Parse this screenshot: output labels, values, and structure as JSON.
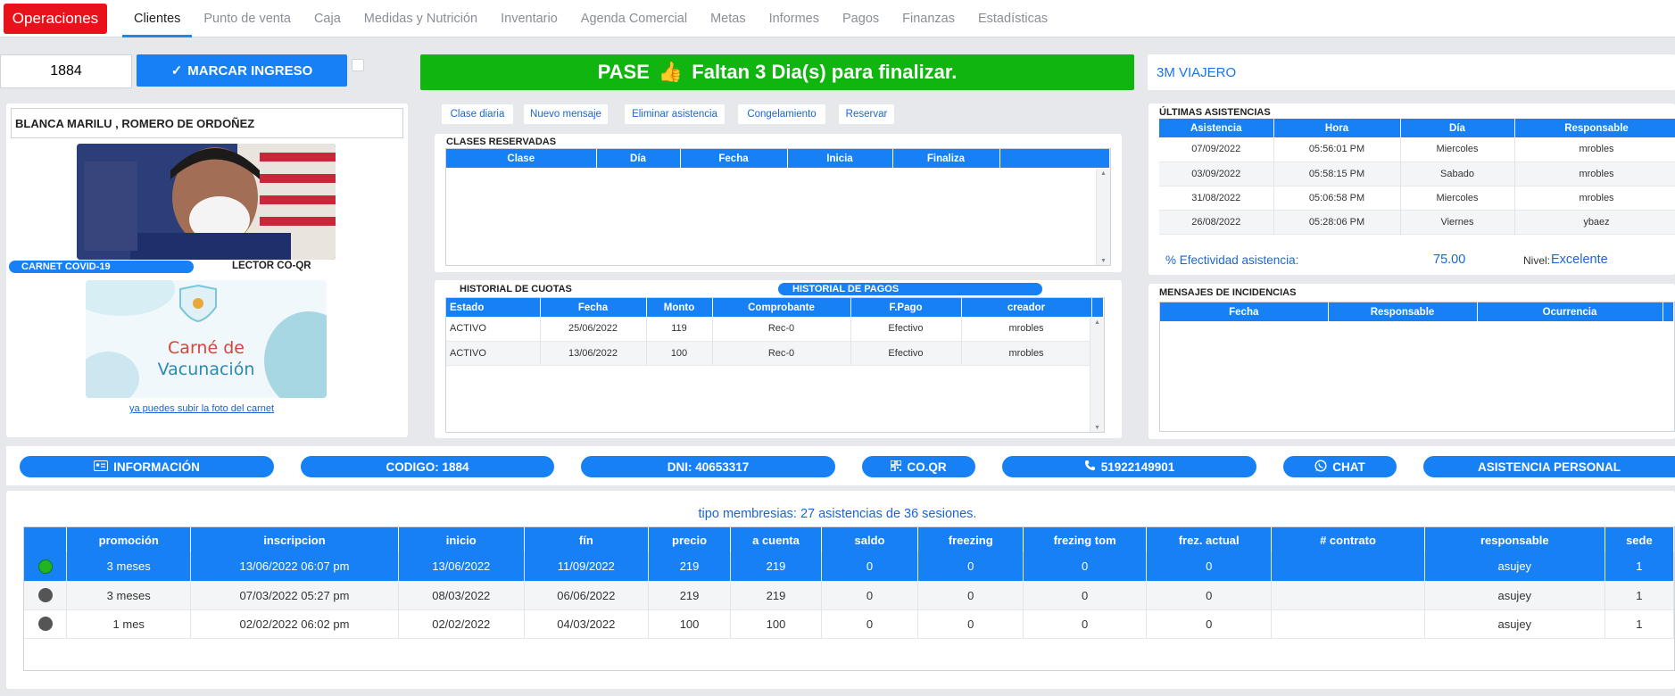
{
  "nav": {
    "brand": "Operaciones",
    "tabs": [
      "Clientes",
      "Punto de venta",
      "Caja",
      "Medidas y Nutrición",
      "Inventario",
      "Agenda Comercial",
      "Metas",
      "Informes",
      "Pagos",
      "Finanzas",
      "Estadísticas"
    ],
    "active_tab": "Clientes"
  },
  "checkin": {
    "code_value": "1884",
    "mark_button": "MARCAR INGRESO"
  },
  "pass": {
    "text_left": "PASE",
    "emoji": "👍",
    "text_right": "Faltan 3 Dia(s) para finalizar."
  },
  "plan_name": "3M VIAJERO",
  "client": {
    "name": "BLANCA MARILU , ROMERO DE ORDOÑEZ",
    "covid_label": "CARNET COVID-19",
    "qr_label": "LECTOR CO-QR",
    "vaccine_line1": "Carné de",
    "vaccine_line2": "Vacunación",
    "upload_link": "ya puedes subir la foto del carnet"
  },
  "actions": [
    "Clase diaria",
    "Nuevo mensaje",
    "Eliminar asistencia",
    "Congelamiento",
    "Reservar"
  ],
  "reserved": {
    "title": "CLASES RESERVADAS",
    "columns": [
      "Clase",
      "Día",
      "Fecha",
      "Inicia",
      "Finaliza",
      ""
    ]
  },
  "history": {
    "title_cuotas": "HISTORIAL DE CUOTAS",
    "title_pagos": "HISTORIAL DE PAGOS",
    "columns": [
      "Estado",
      "Fecha",
      "Monto",
      "Comprobante",
      "F.Pago",
      "creador"
    ],
    "rows": [
      [
        "ACTIVO",
        "25/06/2022",
        "119",
        "Rec-0",
        "Efectivo",
        "mrobles"
      ],
      [
        "ACTIVO",
        "13/06/2022",
        "100",
        "Rec-0",
        "Efectivo",
        "mrobles"
      ]
    ]
  },
  "attendance": {
    "title": "ÚLTIMAS ASISTENCIAS",
    "columns": [
      "Asistencia",
      "Hora",
      "Día",
      "Responsable"
    ],
    "rows": [
      [
        "07/09/2022",
        "05:56:01 PM",
        "Miercoles",
        "mrobles"
      ],
      [
        "03/09/2022",
        "05:58:15 PM",
        "Sabado",
        "mrobles"
      ],
      [
        "31/08/2022",
        "05:06:58 PM",
        "Miercoles",
        "mrobles"
      ],
      [
        "26/08/2022",
        "05:28:06 PM",
        "Viernes",
        "ybaez"
      ]
    ],
    "effectiveness_label": "% Efectividad asistencia:",
    "effectiveness_value": "75.00",
    "level_label": "Nivel:",
    "level_value": "Excelente"
  },
  "incidents": {
    "title": "MENSAJES DE INCIDENCIAS",
    "columns": [
      "Fecha",
      "Responsable",
      "Ocurrencia"
    ]
  },
  "info_bar": {
    "info": "INFORMACIÓN",
    "code": "CODIGO: 1884",
    "dni": "DNI: 40653317",
    "qr": "CO.QR",
    "phone": "51922149901",
    "chat": "CHAT",
    "personal": "ASISTENCIA PERSONAL"
  },
  "memberships": {
    "title": "tipo membresias: 27 asistencias de 36 sesiones.",
    "columns": [
      "",
      "promoción",
      "inscripcion",
      "inicio",
      "fín",
      "precio",
      "a cuenta",
      "saldo",
      "freezing",
      "frezing tom",
      "frez. actual",
      "# contrato",
      "responsable",
      "sede"
    ],
    "rows": [
      [
        "green",
        "3 meses",
        "13/06/2022 06:07 pm",
        "13/06/2022",
        "11/09/2022",
        "219",
        "219",
        "0",
        "0",
        "0",
        "0",
        "",
        "asujey",
        "1"
      ],
      [
        "gray",
        "3 meses",
        "07/03/2022 05:27 pm",
        "08/03/2022",
        "06/06/2022",
        "219",
        "219",
        "0",
        "0",
        "0",
        "0",
        "",
        "asujey",
        "1"
      ],
      [
        "gray",
        "1 mes",
        "02/02/2022 06:02 pm",
        "02/02/2022",
        "04/03/2022",
        "100",
        "100",
        "0",
        "0",
        "0",
        "0",
        "",
        "asujey",
        "1"
      ]
    ]
  },
  "colors": {
    "brand": "#e8131a",
    "primary": "#1680f4",
    "success": "#10b50f"
  }
}
